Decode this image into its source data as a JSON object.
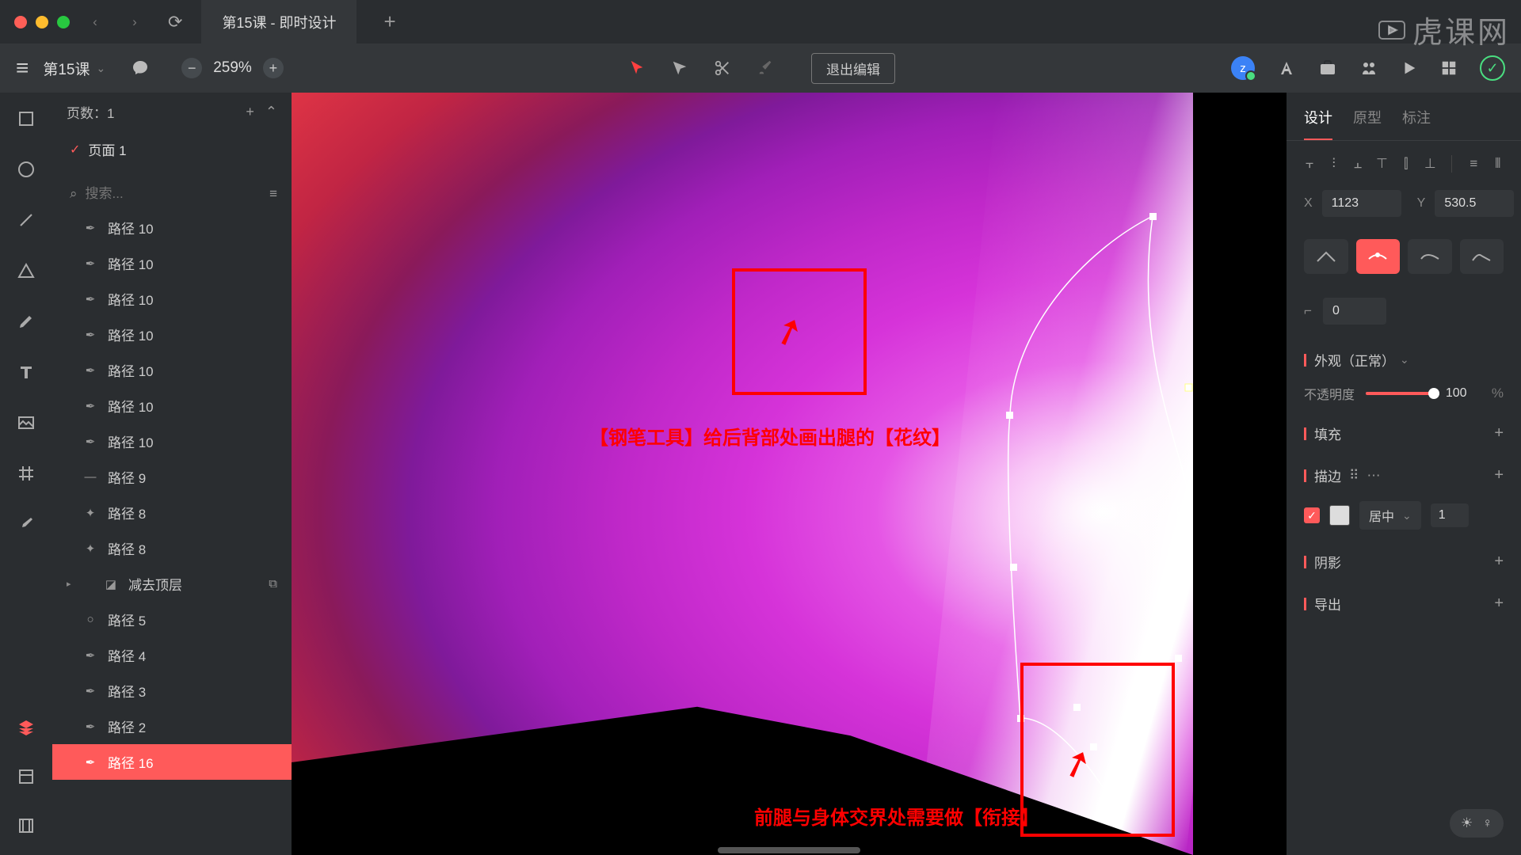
{
  "titlebar": {
    "tab": "第15课 - 即时设计"
  },
  "toolbar": {
    "doc_title": "第15课",
    "zoom": "259%",
    "exit_edit": "退出编辑",
    "avatar_letter": "z"
  },
  "left": {
    "pages_header": "页数：1",
    "page_name": "页面 1",
    "search_placeholder": "搜索...",
    "layers": [
      {
        "icon": "pen",
        "name": "路径 10"
      },
      {
        "icon": "pen",
        "name": "路径 10"
      },
      {
        "icon": "pen",
        "name": "路径 10"
      },
      {
        "icon": "pen",
        "name": "路径 10"
      },
      {
        "icon": "pen",
        "name": "路径 10"
      },
      {
        "icon": "pen",
        "name": "路径 10"
      },
      {
        "icon": "pen",
        "name": "路径 10"
      },
      {
        "icon": "line",
        "name": "路径 9"
      },
      {
        "icon": "vec",
        "name": "路径 8"
      },
      {
        "icon": "vec",
        "name": "路径 8"
      },
      {
        "icon": "bool",
        "name": "减去顶层",
        "indent": true,
        "arrow": true,
        "dupe": true
      },
      {
        "icon": "circ",
        "name": "路径 5"
      },
      {
        "icon": "pen",
        "name": "路径 4"
      },
      {
        "icon": "pen",
        "name": "路径 3"
      },
      {
        "icon": "pen",
        "name": "路径 2"
      },
      {
        "icon": "pen",
        "name": "路径 16",
        "selected": true
      }
    ]
  },
  "annotations": {
    "top": "【钢笔工具】给后背部处画出腿的【花纹】",
    "bottom": "前腿与身体交界处需要做【衔接】"
  },
  "right": {
    "tabs": {
      "design": "设计",
      "proto": "原型",
      "annotate": "标注"
    },
    "x_label": "X",
    "x_val": "1123",
    "y_label": "Y",
    "y_val": "530.5",
    "radius_val": "0",
    "appearance_label": "外观（正常）",
    "opacity_label": "不透明度",
    "opacity_val": "100",
    "opacity_pct": "%",
    "fill_label": "填充",
    "stroke_label": "描边",
    "stroke_pos": "居中",
    "stroke_width": "1",
    "shadow_label": "阴影",
    "export_label": "导出"
  },
  "watermark": "虎课网"
}
